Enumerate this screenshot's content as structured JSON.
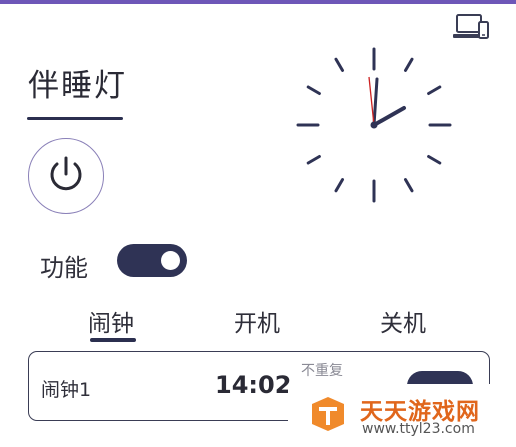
{
  "app": {
    "title": "伴睡灯",
    "accent_color": "#2f3355",
    "top_bar_color": "#6e57b8"
  },
  "toolbar": {
    "device_icon": "laptop-phone-icon"
  },
  "power": {
    "icon": "power-icon"
  },
  "clock": {
    "icon": "analog-clock",
    "hour_hand_color": "#2f3355",
    "second_hand_color": "#cc2222"
  },
  "function": {
    "label": "功能",
    "toggle_on": true
  },
  "tabs": [
    {
      "label": "闹钟",
      "selected": true
    },
    {
      "label": "开机",
      "selected": false
    },
    {
      "label": "关机",
      "selected": false
    }
  ],
  "alarms": [
    {
      "name": "闹钟1",
      "time": "14:02",
      "repeat": "不重复",
      "enabled": true
    }
  ],
  "watermark": {
    "text": "天天游戏网",
    "url": "www.ttyl23.com",
    "color": "#e0661c"
  }
}
